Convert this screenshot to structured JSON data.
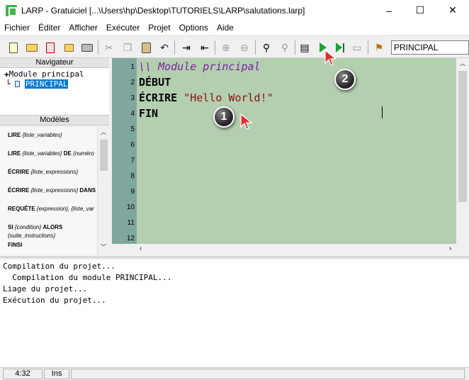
{
  "window": {
    "title": "LARP - Gratuiciel [...\\Users\\hp\\Desktop\\TUTORIELS\\LARP\\salutations.larp]",
    "controls": {
      "minimize": "–",
      "maximize": "☐",
      "close": "✕"
    }
  },
  "menu": [
    "Fichier",
    "Éditer",
    "Afficher",
    "Exécuter",
    "Projet",
    "Options",
    "Aide"
  ],
  "toolbar": {
    "icons": [
      "new-file-icon",
      "open-folder-icon",
      "save-icon",
      "folder-icon",
      "print-icon",
      "cut-icon",
      "copy-icon",
      "paste-icon",
      "undo-icon",
      "indent-icon",
      "outdent-icon",
      "zoom-in-icon",
      "zoom-out-icon",
      "find-icon",
      "replace-icon",
      "compile-icon",
      "run-icon",
      "step-run-icon",
      "console-icon",
      "module-icon"
    ],
    "module_value": "PRINCIPAL"
  },
  "navigator": {
    "header": "Navigateur",
    "root_label": "Module principal",
    "child_label": "PRINCIPAL",
    "tree_prefix_root": "✚",
    "tree_prefix_child": "└"
  },
  "templates": {
    "header": "Modèles",
    "items": [
      {
        "kw": "LIRE",
        "rest": " {liste_variables}"
      },
      {
        "kw": "LIRE",
        "rest": " {liste_variables} ",
        "kw2": "DE",
        "rest2": " {numéro"
      },
      {
        "kw": "ÉCRIRE",
        "rest": " {liste_expressions}"
      },
      {
        "kw": "ÉCRIRE",
        "rest": " {liste_expressions} ",
        "kw2": "DANS"
      },
      {
        "kw": "REQUÊTE",
        "rest": " {expression}, {liste_var"
      },
      {
        "kw": "SI",
        "rest": " {condition} ",
        "kw2": "ALORS"
      },
      {
        "kw": "",
        "rest": "  {suite_instructions}"
      },
      {
        "kw": "FINSI",
        "rest": ""
      }
    ]
  },
  "editor": {
    "line_numbers": [
      "1",
      "2",
      "3",
      "4",
      "5",
      "6",
      "7",
      "8",
      "9",
      "10",
      "11",
      "12"
    ],
    "comment": "\\\\ Module principal",
    "debut": "DÉBUT",
    "ecrire_kw": "ÉCRIRE",
    "ecrire_str": "\"Hello World!\"",
    "fin": "FIN"
  },
  "output": {
    "lines": [
      "Compilation du projet...",
      "  Compilation du module PRINCIPAL...",
      "Liage du projet...",
      "Exécution du projet..."
    ]
  },
  "status": {
    "position": "4:32",
    "mode": "Ins"
  },
  "markers": {
    "one": "1",
    "two": "2"
  },
  "colors": {
    "editor_bg": "#b4cfb0",
    "gutter_bg": "#7fa79d",
    "selection": "#0078d7"
  }
}
